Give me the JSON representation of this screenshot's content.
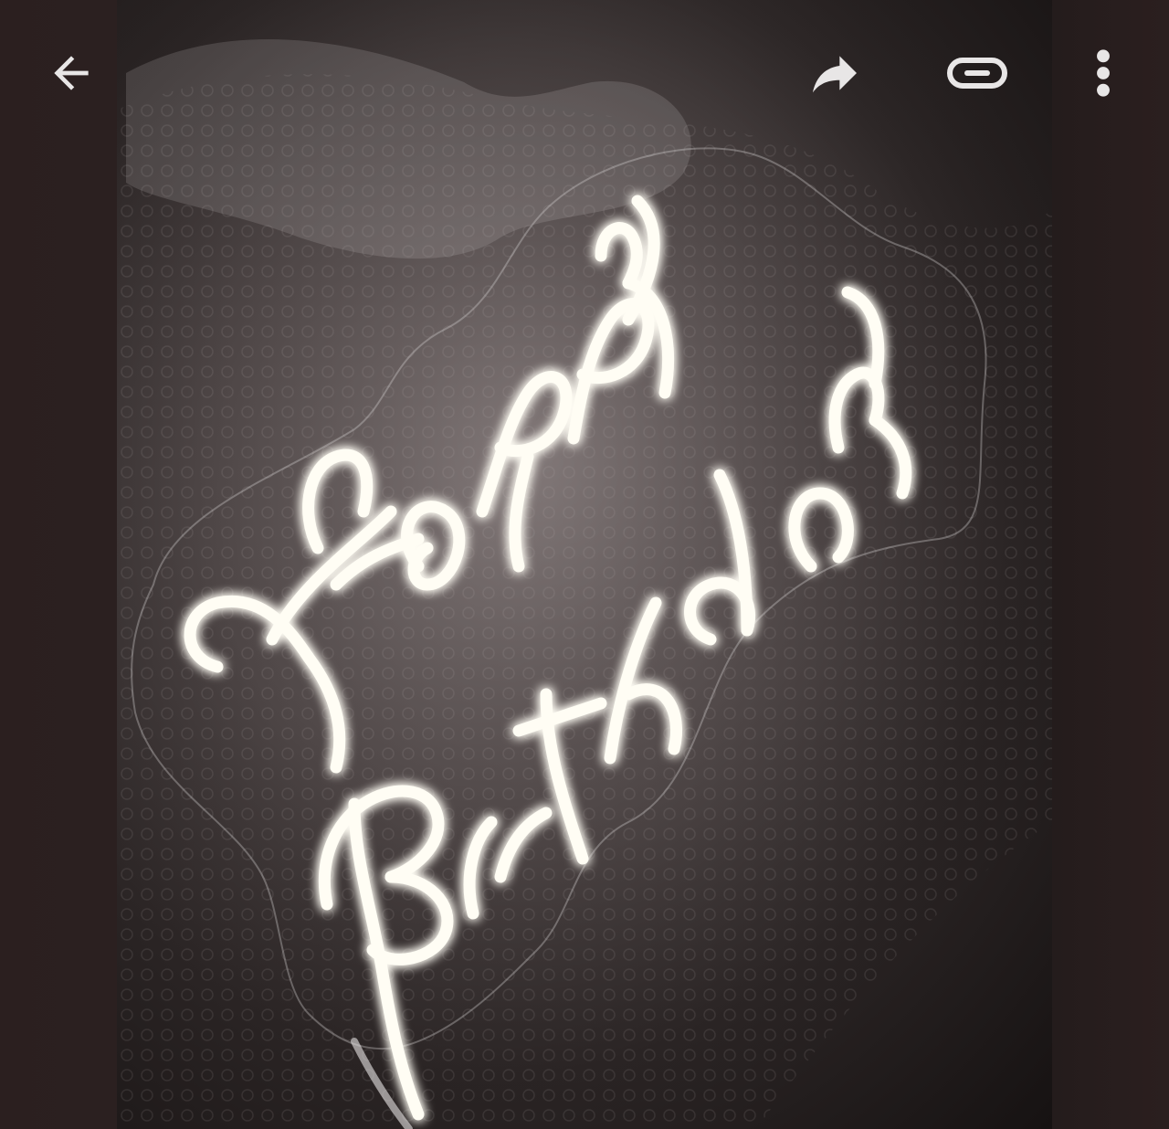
{
  "viewer": {
    "icons": {
      "back": "arrow-back-icon",
      "share": "share-arrow-icon",
      "link": "link-icon",
      "more": "more-vertical-icon"
    },
    "colors": {
      "icon": "#e8e6e6",
      "neon": "#fffdf4",
      "background": "#2a2020"
    }
  },
  "photo": {
    "neon_text_line1": "Happy",
    "neon_text_line2": "Birthday"
  }
}
